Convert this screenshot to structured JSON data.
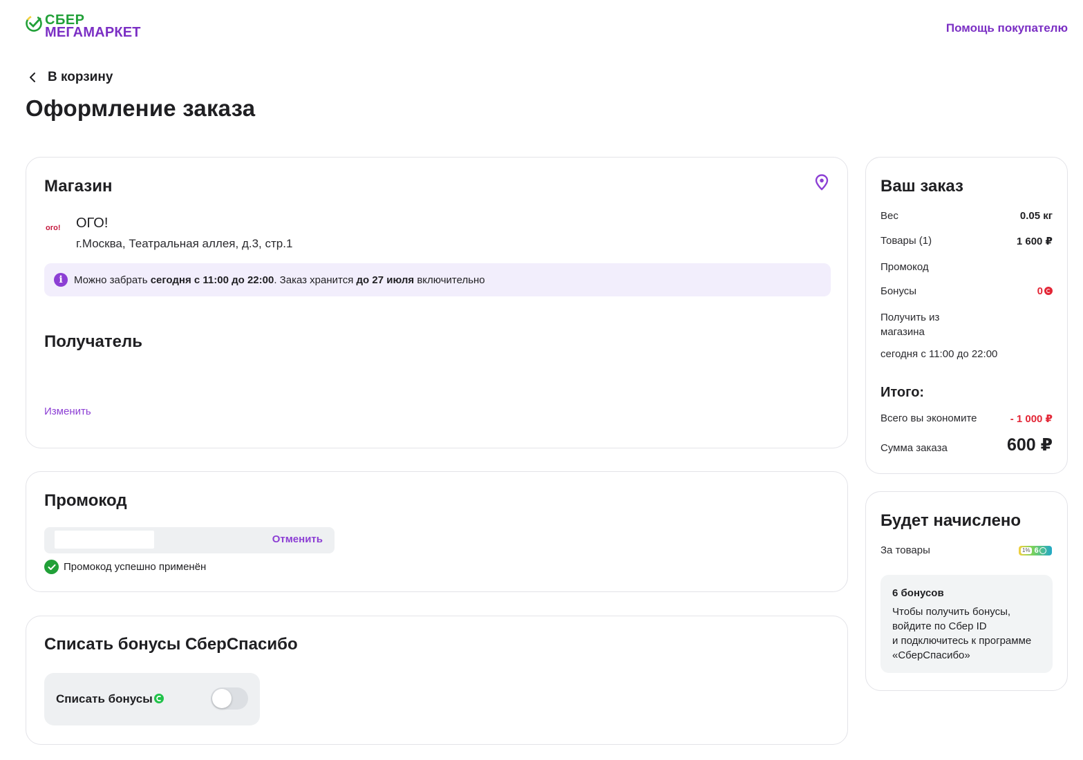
{
  "header": {
    "logo_line1": "СБЕР",
    "logo_line2": "МЕГАМАРКЕТ",
    "help_link": "Помощь покупателю"
  },
  "nav": {
    "back_label": "В корзину"
  },
  "page_title": "Оформление заказа",
  "store": {
    "title": "Магазин",
    "name": "ОГО!",
    "logo_text": "ого!",
    "address": "г.Москва, Театральная аллея, д.3, стр.1",
    "info": {
      "prefix": "Можно забрать ",
      "time_bold": "сегодня с 11:00 до 22:00",
      "middle": ". Заказ хранится ",
      "date_bold": "до 27 июля",
      "suffix": " включительно"
    }
  },
  "recipient": {
    "title": "Получатель",
    "change_link": "Изменить"
  },
  "promo": {
    "title": "Промокод",
    "input_value": "",
    "cancel_label": "Отменить",
    "success_text": "Промокод успешно применён"
  },
  "bonuses": {
    "title": "Списать бонусы СберСпасибо",
    "toggle_label": "Списать бонусы",
    "toggle_on": false
  },
  "order": {
    "title": "Ваш заказ",
    "weight_label": "Вес",
    "weight_value": "0.05 кг",
    "goods_label": "Товары (1)",
    "goods_value": "1 600 ₽",
    "promo_label": "Промокод",
    "bonus_label": "Бонусы",
    "bonus_value": "0",
    "pickup_label": "Получить из магазина",
    "pickup_value": "сегодня  с 11:00 до 22:00",
    "total_title": "Итого:",
    "savings_label": "Всего вы экономите",
    "savings_value": "- 1 000 ₽",
    "sum_label": "Сумма заказа",
    "sum_value": "600 ₽"
  },
  "accrual": {
    "title": "Будет начислено",
    "for_goods_label": "За товары",
    "badge_percent": "1%",
    "badge_value": "6",
    "box_title": "6 бонусов",
    "box_text": "Чтобы получить бонусы,\nвойдите по Сбер ID\nи подключитесь к программе\n«СберСпасибо»"
  },
  "colors": {
    "brand_green": "#21a038",
    "brand_purple": "#7b2fc4",
    "accent_purple": "#8c3fd4",
    "info_bg": "#f2eefc",
    "discount_red": "#e32636"
  }
}
